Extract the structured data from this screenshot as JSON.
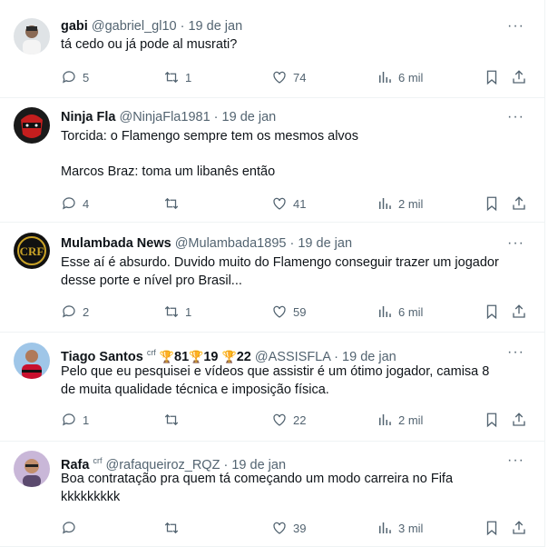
{
  "tweets": [
    {
      "name": "gabi",
      "badge": "",
      "trophies": [],
      "handle": "@gabriel_gl10",
      "date": "19 de jan",
      "lines": [
        "tá cedo ou já pode al musrati?"
      ],
      "replies": "5",
      "retweets": "1",
      "likes": "74",
      "views": "6 mil",
      "avatar": "person-photo"
    },
    {
      "name": "Ninja Fla",
      "badge": "",
      "trophies": [],
      "handle": "@NinjaFla1981",
      "date": "19 de jan",
      "lines": [
        "Torcida: o Flamengo sempre tem os mesmos alvos",
        "",
        "Marcos Braz: toma um libanês então"
      ],
      "replies": "4",
      "retweets": "",
      "likes": "41",
      "views": "2 mil",
      "avatar": "ninja-mask"
    },
    {
      "name": "Mulambada News",
      "badge": "",
      "trophies": [],
      "handle": "@Mulambada1895",
      "date": "19 de jan",
      "lines": [
        "Esse aí é absurdo. Duvido muito do Flamengo conseguir trazer um jogador",
        "desse porte e nível pro Brasil..."
      ],
      "replies": "2",
      "retweets": "1",
      "likes": "59",
      "views": "6 mil",
      "avatar": "crf-crest"
    },
    {
      "name": "Tiago Santos",
      "badge": "crf",
      "trophies": [
        "81",
        "19",
        "22"
      ],
      "handle": "@ASSISFLA",
      "date": "19 de jan",
      "lines": [
        "Pelo que eu pesquisei e vídeos que assistir é um ótimo jogador, camisa 8",
        "de muita qualidade técnica e imposição física."
      ],
      "replies": "1",
      "retweets": "",
      "likes": "22",
      "views": "2 mil",
      "avatar": "person-photo"
    },
    {
      "name": "Rafa",
      "badge": "crf",
      "trophies": [],
      "handle": "@rafaqueiroz_RQZ",
      "date": "19 de jan",
      "lines": [
        "Boa contratação pra quem tá começando um modo carreira no Fifa",
        "kkkkkkkkk"
      ],
      "replies": "",
      "retweets": "",
      "likes": "39",
      "views": "3 mil",
      "avatar": "person-photo"
    }
  ],
  "ui": {
    "dot": "·",
    "more": "···",
    "trophy_glyph": "🏆"
  },
  "colors": {
    "text": "#0f1419",
    "secondary": "#536471",
    "divider": "#eff3f4"
  }
}
